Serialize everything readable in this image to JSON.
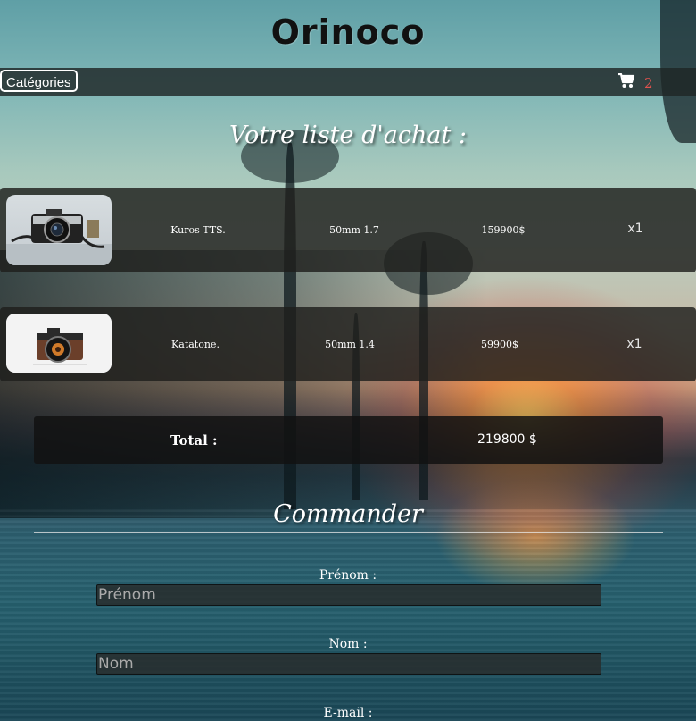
{
  "header": {
    "site_title": "Orinoco"
  },
  "nav": {
    "categories_label": "Catégories",
    "cart_icon": "shopping-cart-icon",
    "cart_count": "2",
    "cart_count_color": "#e0524e"
  },
  "cart_list": {
    "title": "Votre liste d'achat :",
    "items": [
      {
        "name": "Kuros TTS.",
        "lens": "50mm 1.7",
        "price": "159900$",
        "quantity": "x1",
        "image": "camera-photo"
      },
      {
        "name": "Katatone.",
        "lens": "50mm 1.4",
        "price": "59900$",
        "quantity": "x1",
        "image": "camera-photo"
      }
    ],
    "total_label": "Total :",
    "total_value": "219800 $"
  },
  "order_form": {
    "title": "Commander",
    "fields": [
      {
        "label": "Prénom :",
        "placeholder": "Prénom"
      },
      {
        "label": "Nom :",
        "placeholder": "Nom"
      },
      {
        "label": "E-mail :"
      }
    ]
  }
}
